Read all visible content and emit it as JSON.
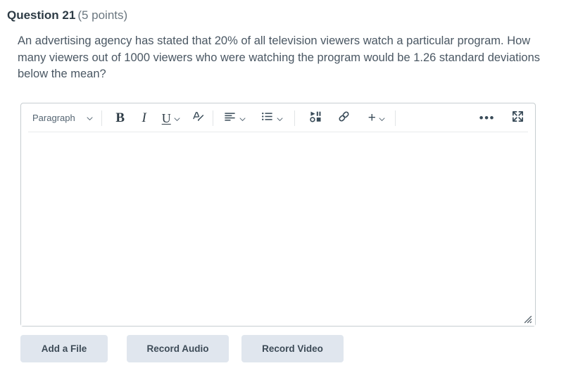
{
  "question": {
    "title": "Question 21",
    "points": "(5 points)",
    "text": "An advertising agency has stated that 20% of all television viewers watch a particular program. How many viewers out of 1000 viewers who were watching the program would be 1.26 standard deviations below the mean?"
  },
  "editor": {
    "toolbar": {
      "paragraph_label": "Paragraph",
      "bold_label": "B",
      "italic_label": "I",
      "underline_label": "U",
      "text_color_label": "A",
      "more_label": "•••",
      "plus_label": "+",
      "icons": [
        "block-format-dropdown",
        "bold-icon",
        "italic-icon",
        "underline-icon",
        "text-color-icon",
        "align-left-icon",
        "bullet-list-icon",
        "media-icon",
        "link-icon",
        "insert-plus-icon",
        "more-options-icon",
        "fullscreen-icon"
      ]
    },
    "content": "",
    "placeholder": ""
  },
  "attachments": {
    "add_file_label": "Add a File",
    "record_audio_label": "Record Audio",
    "record_video_label": "Record Video"
  },
  "colors": {
    "page_background": "#ffffff",
    "heading_text": "#2d3b45",
    "points_text": "#6b7780",
    "body_text": "#4a5763",
    "editor_border": "#c7cdd1",
    "toolbar_divider": "#e8eaec",
    "button_background": "#e0e6ee",
    "button_text": "#3d4b57",
    "icon_color": "#394b58"
  }
}
